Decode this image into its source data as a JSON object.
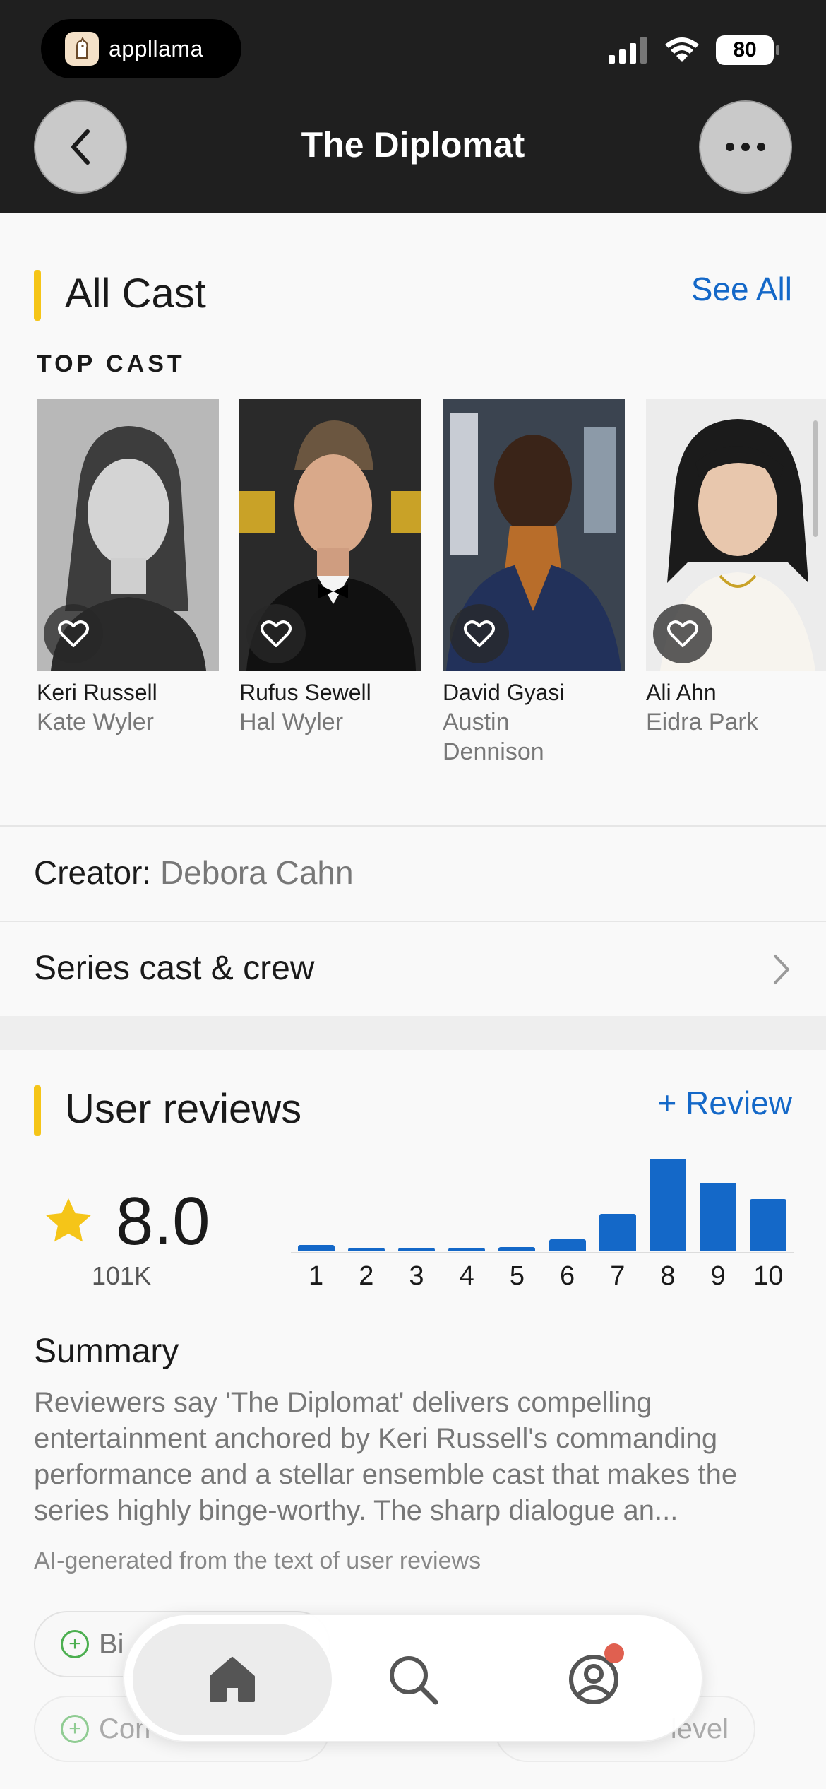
{
  "header": {
    "app_name": "appllama",
    "battery": "80",
    "title": "The Diplomat"
  },
  "cast_section": {
    "title": "All Cast",
    "see_all": "See All",
    "subtitle": "TOP CAST",
    "cast": [
      {
        "actor": "Keri Russell",
        "role": "Kate Wyler"
      },
      {
        "actor": "Rufus Sewell",
        "role": "Hal Wyler"
      },
      {
        "actor": "David Gyasi",
        "role": "Austin Dennison"
      },
      {
        "actor": "Ali Ahn",
        "role": "Eidra Park"
      }
    ]
  },
  "creator": {
    "label": "Creator:",
    "value": "Debora Cahn"
  },
  "crew_link": "Series cast & crew",
  "reviews": {
    "title": "User reviews",
    "add_review": "+ Review",
    "rating": "8.0",
    "votes": "101K",
    "summary_title": "Summary",
    "summary_text": "Reviewers say 'The Diplomat' delivers compelling entertainment anchored by Keri Russell's commanding performance and a stellar ensemble cast that makes the series highly binge-worthy. The sharp dialogue an...",
    "ai_note": "AI-generated from the text of user reviews",
    "chips": [
      "Bi",
      "Con",
      "level"
    ]
  },
  "chart_data": {
    "type": "bar",
    "categories": [
      "1",
      "2",
      "3",
      "4",
      "5",
      "6",
      "7",
      "8",
      "9",
      "10"
    ],
    "values": [
      3,
      1,
      1,
      1,
      2,
      6,
      20,
      50,
      37,
      28
    ],
    "ylim": [
      0,
      50
    ],
    "color": "#1468c8"
  },
  "tabbar": {
    "items": [
      "home-icon",
      "search-icon",
      "profile-icon"
    ],
    "active": "home-icon"
  }
}
